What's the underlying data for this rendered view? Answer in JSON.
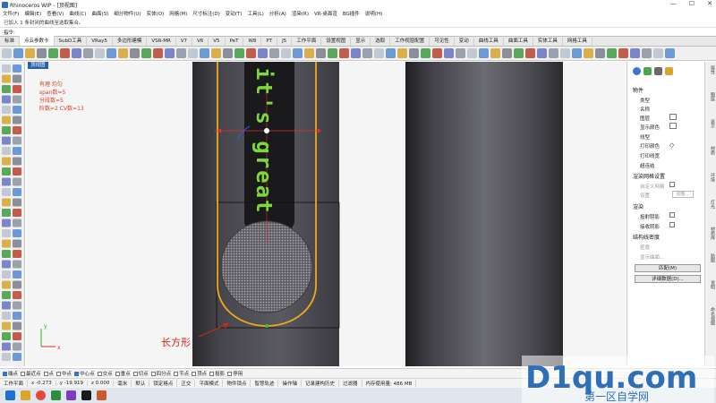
{
  "window": {
    "title": "Rhinoceros WIP - [顶视图]",
    "controls": [
      "—",
      "☐",
      "✕"
    ]
  },
  "menu": [
    "文件(F)",
    "编辑(E)",
    "查看(V)",
    "曲线(C)",
    "曲面(S)",
    "细分物件(U)",
    "实体(O)",
    "网格(M)",
    "尺寸标注(D)",
    "变动(T)",
    "工具(L)",
    "分析(A)",
    "渲染(R)",
    "VR-桌面渲",
    "BG插件",
    "说明(H)"
  ],
  "command": {
    "history": "已加入 1 条封闭的曲线至选取集合。",
    "prompt": "指令:"
  },
  "tabs": [
    {
      "label": "标准",
      "active": false
    },
    {
      "label": "点云参数卡",
      "active": true
    },
    {
      "label": "SubD工具",
      "active": false
    },
    {
      "label": "VRay5",
      "active": false
    },
    {
      "label": "多边形建模",
      "active": false
    },
    {
      "label": "VSR-MR",
      "active": false
    },
    {
      "label": "V7",
      "active": false
    },
    {
      "label": "V6",
      "active": false
    },
    {
      "label": "V5",
      "active": false
    },
    {
      "label": "PeT",
      "active": false
    },
    {
      "label": "W8",
      "active": false
    },
    {
      "label": "PT",
      "active": false
    },
    {
      "label": "J5",
      "active": false
    },
    {
      "label": "工作平面",
      "active": false
    },
    {
      "label": "设置视图",
      "active": false
    },
    {
      "label": "显示",
      "active": false
    },
    {
      "label": "选取",
      "active": false
    },
    {
      "label": "工作视窗配置",
      "active": false
    },
    {
      "label": "可见性",
      "active": false
    },
    {
      "label": "变动",
      "active": false
    },
    {
      "label": "曲线工具",
      "active": false
    },
    {
      "label": "曲面工具",
      "active": false
    },
    {
      "label": "实体工具",
      "active": false
    },
    {
      "label": "网格工具",
      "active": false
    }
  ],
  "viewport": {
    "name": "顶视图",
    "annotation_lines": [
      "有理  均匀",
      "span数=5",
      "分段数=5",
      "阶数=2   CV数=13"
    ],
    "callout": "长方形",
    "engraving": "it's great",
    "axis_y": "y",
    "axis_x": "x"
  },
  "panel": {
    "section_object": "物件",
    "rows": [
      "类型",
      "名称",
      "图层",
      "显示颜色",
      "线型",
      "打印颜色",
      "打印线宽",
      "超连结"
    ],
    "section_mesh": "渲染网格设置",
    "mesh_custom": "自定义网格",
    "mesh_settings": "设置",
    "mesh_adjust": "调整...",
    "section_render": "渲染",
    "render_cast": "投射阴影",
    "render_receive": "接收阴影",
    "section_iso": "结构线密度",
    "iso_density": "密度",
    "iso_show": "显示曲面...",
    "btn_match": "匹配(M)",
    "btn_detail": "详细数据(D)...",
    "side_tabs": [
      "属性",
      "图层",
      "显示",
      "材质",
      "环境",
      "灯光",
      "材质库",
      "贴图",
      "说明",
      "命名视图"
    ]
  },
  "osnap": [
    {
      "label": "端点",
      "on": true
    },
    {
      "label": "最近点",
      "on": false
    },
    {
      "label": "点",
      "on": false
    },
    {
      "label": "中点",
      "on": false
    },
    {
      "label": "中心点",
      "on": true
    },
    {
      "label": "交点",
      "on": false
    },
    {
      "label": "垂点",
      "on": false
    },
    {
      "label": "切点",
      "on": false
    },
    {
      "label": "四分点",
      "on": false
    },
    {
      "label": "节点",
      "on": false
    },
    {
      "label": "顶点",
      "on": false
    },
    {
      "label": "投影",
      "on": false
    },
    {
      "label": "停用",
      "on": false
    }
  ],
  "status": [
    "工作平面",
    "x -0.273",
    "y -19.919",
    "z 0.000",
    "毫米",
    "默认",
    "锁定格点",
    "正交",
    "平面模式",
    "物件锁点",
    "智慧轨迹",
    "操作轴",
    "记录建构历史",
    "过滤器",
    "内存使用量: 486 MB"
  ],
  "watermark": {
    "brand": "D1qu.com",
    "sub": "第一区自学网"
  },
  "colors": {
    "accent": "#2b5fa8",
    "annotation": "#d23a2a",
    "curve": "#f2a81c",
    "engraving": "#7fd83a"
  }
}
